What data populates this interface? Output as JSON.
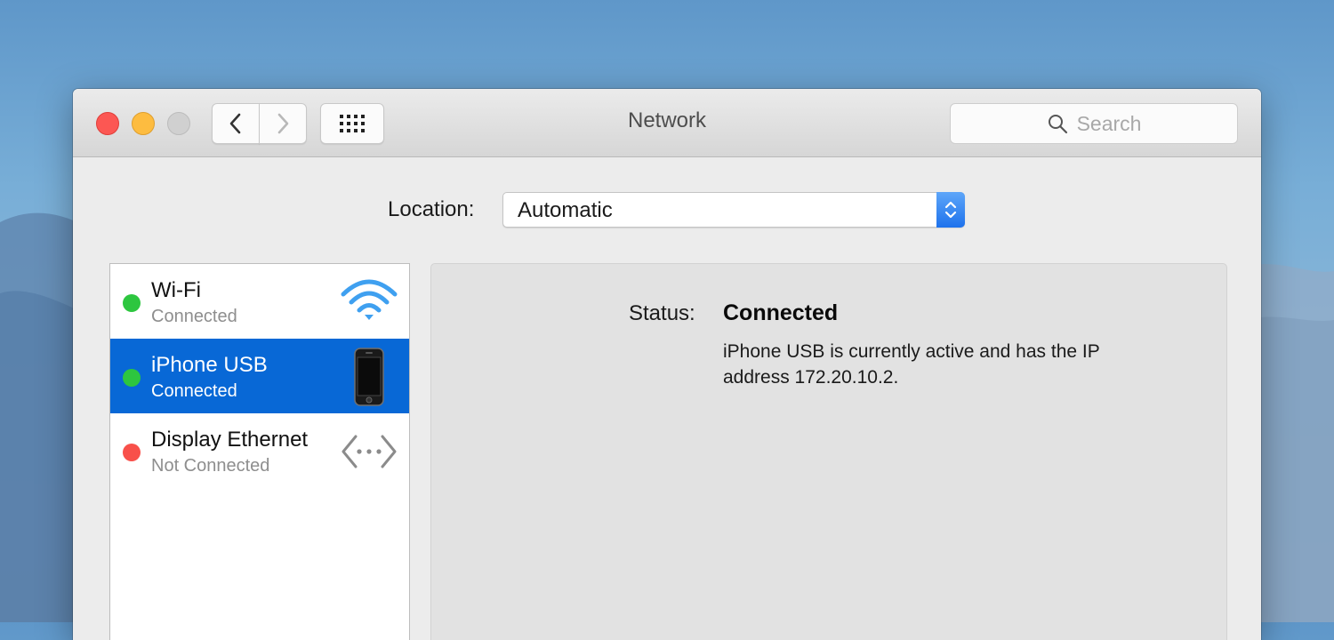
{
  "window": {
    "title": "Network",
    "search_placeholder": "Search"
  },
  "location": {
    "label": "Location:",
    "value": "Automatic"
  },
  "services": [
    {
      "name": "Wi-Fi",
      "status": "Connected",
      "status_color": "#2dc63f",
      "icon": "wifi-icon",
      "selected": false
    },
    {
      "name": "iPhone USB",
      "status": "Connected",
      "status_color": "#2dc63f",
      "icon": "iphone-icon",
      "selected": true
    },
    {
      "name": "Display Ethernet",
      "status": "Not Connected",
      "status_color": "#f8504a",
      "icon": "ethernet-icon",
      "selected": false
    }
  ],
  "detail": {
    "status_label": "Status:",
    "status_value": "Connected",
    "description": "iPhone USB is currently active and has the IP address 172.20.10.2."
  },
  "colors": {
    "selection": "#0868d6",
    "connected": "#2dc63f",
    "not_connected": "#f8504a",
    "accent": "#1e72ec"
  }
}
